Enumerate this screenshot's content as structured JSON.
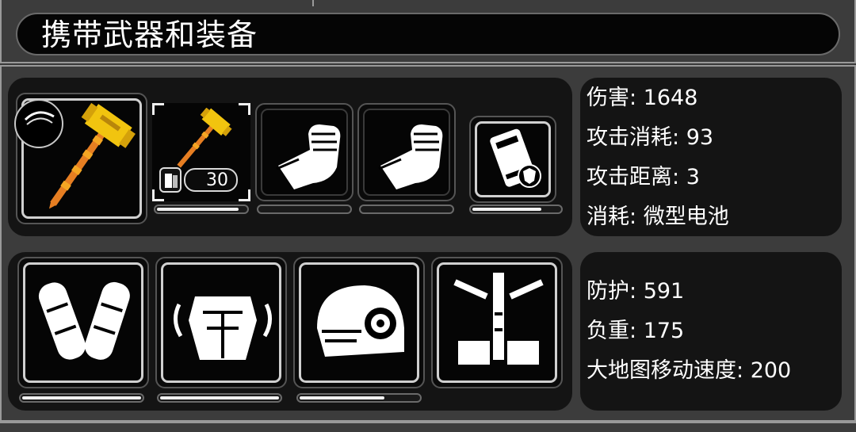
{
  "title": "携带武器和装备",
  "weapon": {
    "equipped_icon": "golden-hammer-icon",
    "secondary_icon": "round-black-badge-icon",
    "slots": [
      {
        "icon": "golden-hammer-icon",
        "ammo_icon": "battery-cell-icon",
        "ammo_count": "30",
        "durability": 0.92
      },
      {
        "icon": "fist-icon",
        "durability": 0
      },
      {
        "icon": "fist-icon",
        "durability": 0
      }
    ],
    "consumable": {
      "icon": "battery-shield-icon",
      "durability": 0.8
    }
  },
  "weapon_stats": [
    {
      "label": "伤害:",
      "value": "1648"
    },
    {
      "label": "攻击消耗:",
      "value": "93"
    },
    {
      "label": "攻击距离:",
      "value": "3"
    },
    {
      "label": "消耗:",
      "value": "微型电池"
    }
  ],
  "armor": {
    "slots": [
      {
        "icon": "armored-arms-icon",
        "durability": 1.0
      },
      {
        "icon": "chest-armor-icon",
        "durability": 1.0
      },
      {
        "icon": "helmet-icon",
        "durability": 0.72
      },
      {
        "icon": "exoskeleton-frame-icon",
        "durability": null
      }
    ]
  },
  "armor_stats": [
    {
      "label": "防护:",
      "value": "591"
    },
    {
      "label": "负重:",
      "value": "175"
    },
    {
      "label": "大地图移动速度:",
      "value": "200"
    }
  ],
  "colors": {
    "accent_gold": "#f1c40f",
    "accent_orange": "#e67e22",
    "bar_fill": "#f2f2f2"
  }
}
